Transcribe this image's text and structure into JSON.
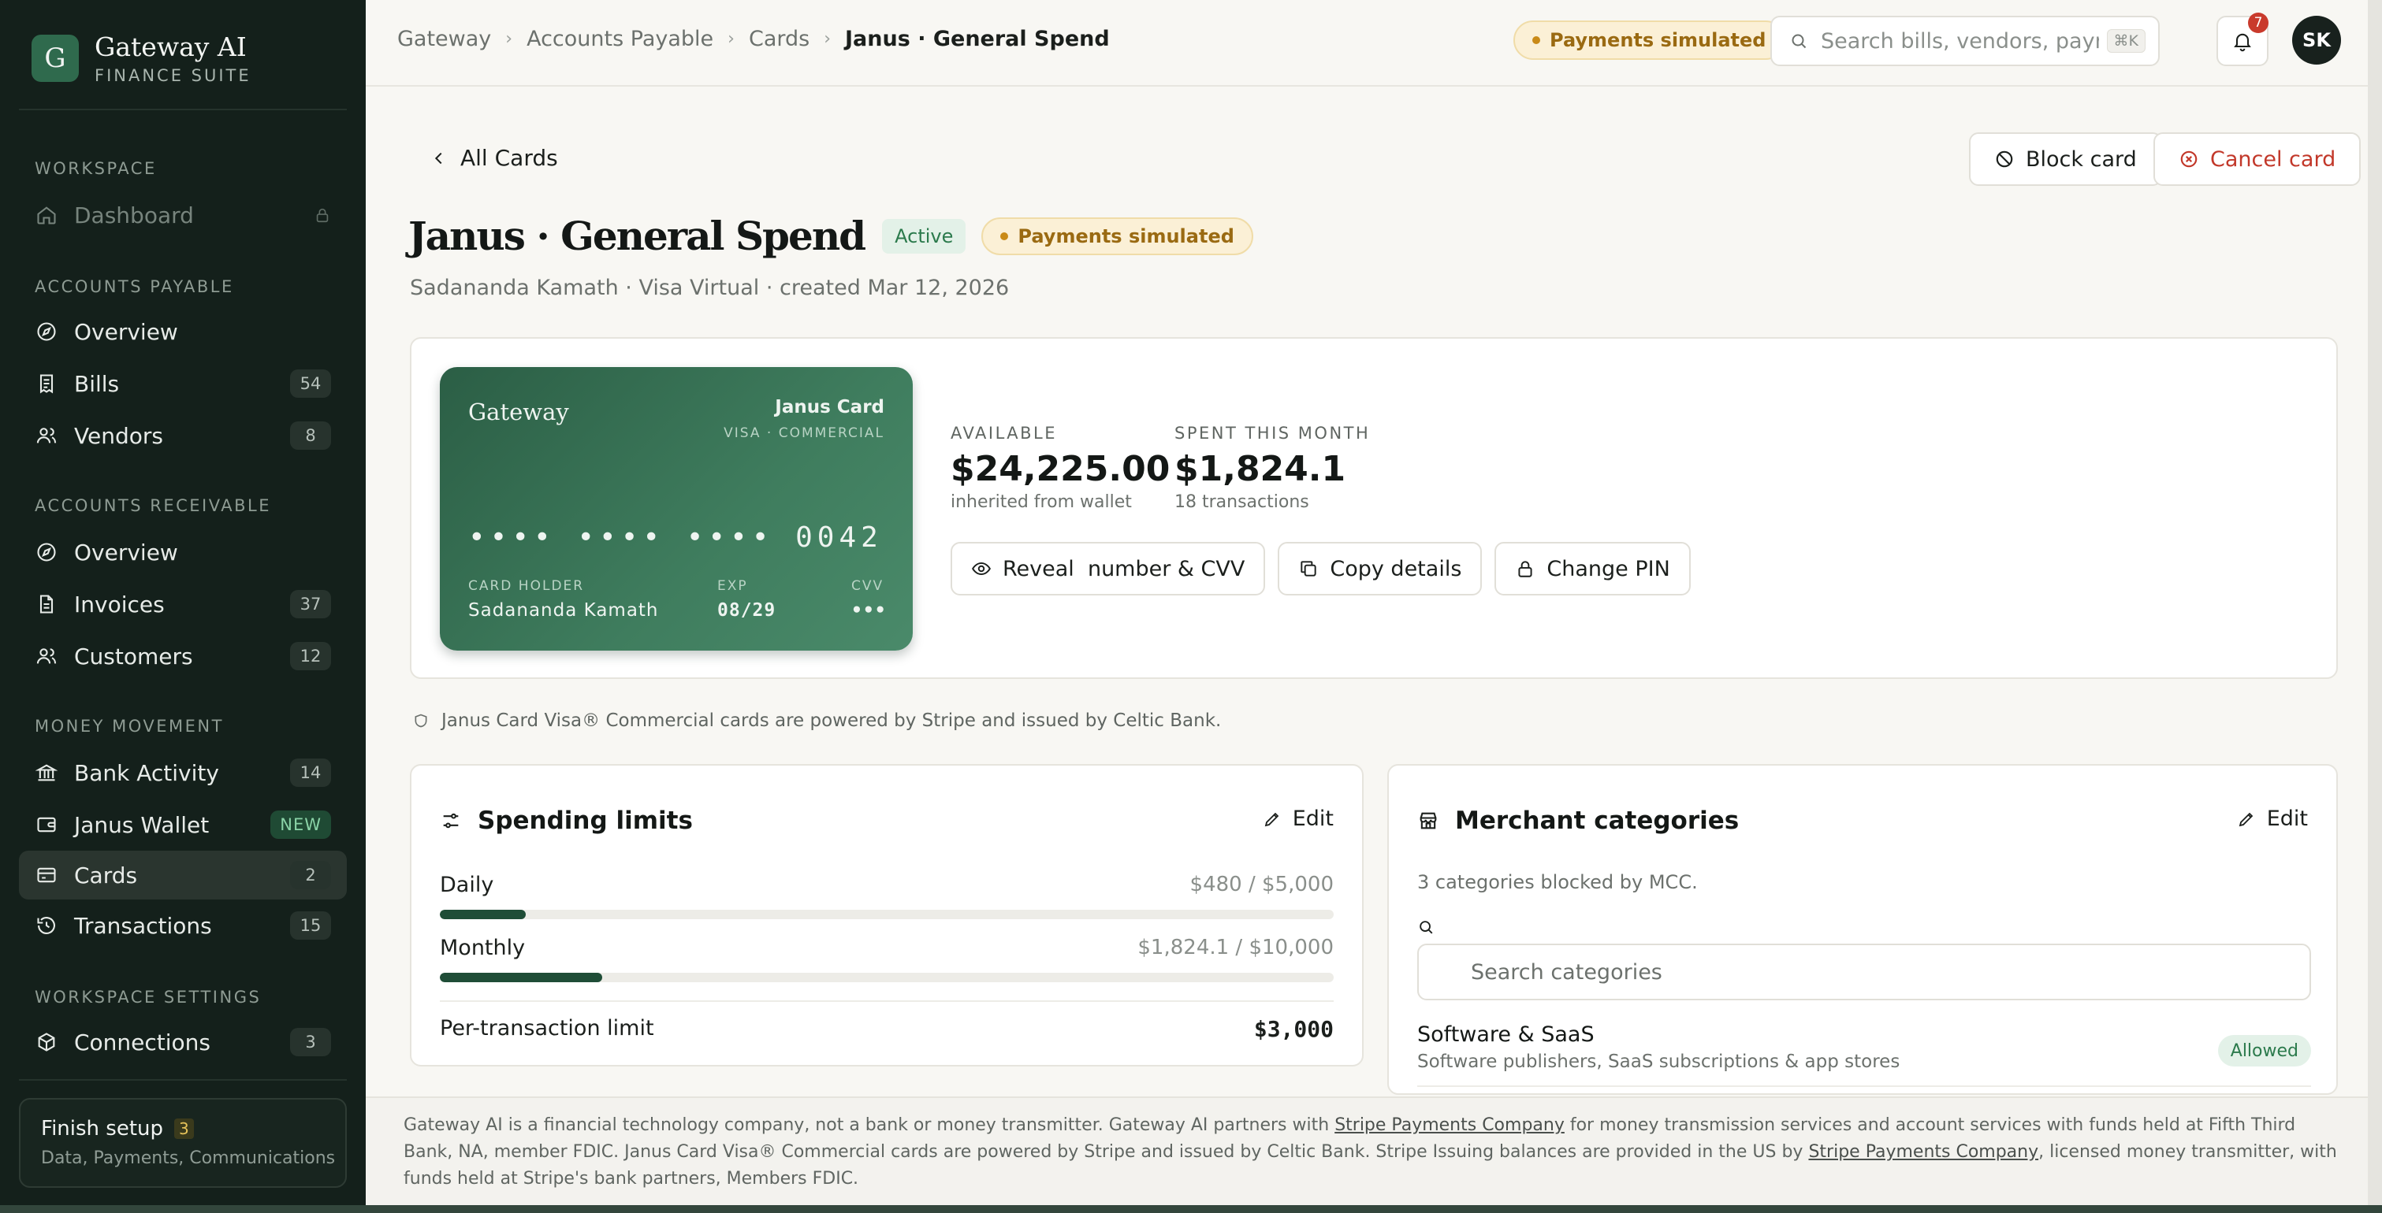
{
  "brand": {
    "logo_letter": "G",
    "name": "Gateway AI",
    "sub": "FINANCE SUITE"
  },
  "sidebar": {
    "sections": {
      "workspace": "WORKSPACE",
      "payable": "ACCOUNTS PAYABLE",
      "receivable": "ACCOUNTS RECEIVABLE",
      "money": "MONEY MOVEMENT",
      "settings": "WORKSPACE SETTINGS"
    },
    "items": {
      "dashboard": {
        "label": "Dashboard"
      },
      "ap_overview": {
        "label": "Overview"
      },
      "bills": {
        "label": "Bills",
        "count": "54"
      },
      "vendors": {
        "label": "Vendors",
        "count": "8"
      },
      "ar_overview": {
        "label": "Overview"
      },
      "invoices": {
        "label": "Invoices",
        "count": "37"
      },
      "customers": {
        "label": "Customers",
        "count": "12"
      },
      "bank_activity": {
        "label": "Bank Activity",
        "count": "14"
      },
      "janus_wallet": {
        "label": "Janus Wallet",
        "badge": "NEW"
      },
      "cards": {
        "label": "Cards",
        "count": "2"
      },
      "transactions": {
        "label": "Transactions",
        "count": "15"
      },
      "connections": {
        "label": "Connections",
        "count": "3"
      }
    },
    "setup": {
      "title": "Finish setup",
      "count": "3",
      "sub": "Data, Payments, Communications"
    }
  },
  "topbar": {
    "breadcrumbs": [
      "Gateway",
      "Accounts Payable",
      "Cards",
      "Janus · General Spend"
    ],
    "sim_pill": "Payments simulated",
    "search_placeholder": "Search bills, vendors, payments...",
    "shortcut": "⌘K",
    "notifications": "7",
    "avatar": "SK"
  },
  "page": {
    "back": "All Cards",
    "block_btn": "Block card",
    "cancel_btn": "Cancel card",
    "title": "Janus · General Spend",
    "status": "Active",
    "sim_pill": "Payments simulated",
    "subtitle": "Sadananda Kamath · Visa Virtual · created Mar 12, 2026"
  },
  "card": {
    "brand": "Gateway",
    "name": "Janus Card",
    "network": "VISA · COMMERCIAL",
    "number": "•••• •••• •••• 0042",
    "holder_label": "CARD HOLDER",
    "holder": "Sadananda Kamath",
    "exp_label": "EXP",
    "exp": "08/29",
    "cvv_label": "CVV",
    "cvv": "•••"
  },
  "stats": {
    "available_label": "AVAILABLE",
    "available": "$24,225.00",
    "available_sub": "inherited from wallet",
    "spent_label": "SPENT THIS MONTH",
    "spent": "$1,824.1",
    "spent_sub": "18 transactions"
  },
  "actions": {
    "reveal": "Reveal  number & CVV",
    "copy": "Copy details",
    "pin": "Change PIN"
  },
  "notice": "Janus Card Visa® Commercial cards are powered by Stripe and issued by Celtic Bank.",
  "limits": {
    "title": "Spending limits",
    "edit": "Edit",
    "daily": {
      "label": "Daily",
      "used": "$480",
      "sep": " / ",
      "cap": "$5,000",
      "fraction": 0.096
    },
    "monthly": {
      "label": "Monthly",
      "used": "$1,824.1",
      "sep": " / ",
      "cap": "$10,000",
      "fraction": 0.182
    },
    "per_tx": {
      "label": "Per-transaction limit",
      "value": "$3,000"
    }
  },
  "merchant": {
    "title": "Merchant categories",
    "edit": "Edit",
    "note": "3 categories blocked by MCC.",
    "search_placeholder": "Search categories",
    "items": [
      {
        "name": "Software & SaaS",
        "desc": "Software publishers, SaaS subscriptions & app stores",
        "status": "Allowed"
      }
    ]
  },
  "footer": {
    "p1": "Gateway AI is a financial technology company, not a bank or money transmitter. Gateway AI partners with ",
    "link1": "Stripe Payments Company",
    "p2": " for money transmission services and account services with funds held at Fifth Third Bank, NA, member FDIC. Janus Card Visa® Commercial cards are powered by Stripe and issued by Celtic Bank. Stripe Issuing balances are provided in the US by ",
    "link2": "Stripe Payments Company",
    "p3": ", licensed money transmitter, with funds held at Stripe's bank partners, Members FDIC."
  }
}
